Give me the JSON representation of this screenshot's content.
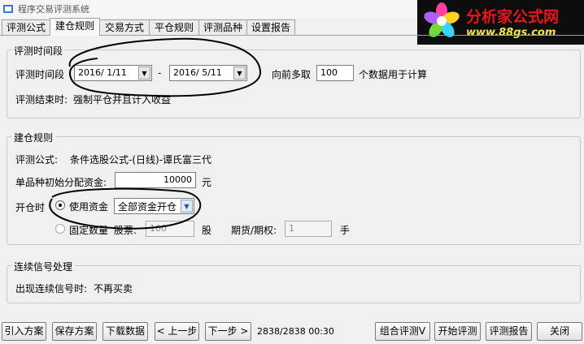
{
  "window": {
    "title": "程序交易评测系统"
  },
  "logo": {
    "brand": "分析家公式网",
    "url": "www.88gs.com"
  },
  "tabs": [
    {
      "label": "评测公式",
      "active": false
    },
    {
      "label": "建仓规则",
      "active": true
    },
    {
      "label": "交易方式",
      "active": false
    },
    {
      "label": "平仓规则",
      "active": false
    },
    {
      "label": "评测品种",
      "active": false
    },
    {
      "label": "设置报告",
      "active": false
    }
  ],
  "period_group": {
    "title": "评测时间段",
    "range_label": "评测时间段",
    "start_date": "2016/ 1/11",
    "dash": "-",
    "end_date": "2016/ 5/11",
    "lookback_label": "向前多取",
    "lookback_value": "100",
    "lookback_suffix": "个数据用于计算",
    "end_label": "评测结束时:",
    "end_value": "强制平仓并且计入收益"
  },
  "build_group": {
    "title": "建仓规则",
    "formula_label": "评测公式:",
    "formula_value": "条件选股公式-(日线)-谭氏富三代",
    "capital_label": "单品种初始分配资金:",
    "capital_value": "10000",
    "capital_unit": "元",
    "open_label": "开仓时",
    "use_funds_label": "使用资金",
    "use_funds_option": "全部资金开仓",
    "fixed_qty_label": "固定数量",
    "stock_label": "股票:",
    "stock_value": "100",
    "stock_unit": "股",
    "futures_label": "期货/期权:",
    "futures_value": "1",
    "futures_unit": "手"
  },
  "signal_group": {
    "title": "连续信号处理",
    "label": "出现连续信号时:",
    "value": "不再买卖"
  },
  "toolbar": {
    "import_label": "引入方案",
    "save_label": "保存方案",
    "download_label": "下载数据",
    "prev_label": "< 上一步",
    "next_label": "下一步 >",
    "progress_text": "2838/2838 00:30",
    "combo_eval_label": "组合评测V",
    "start_label": "开始评测",
    "report_label": "评测报告",
    "close_label": "关闭"
  },
  "colors": {
    "marker": "#000000",
    "accent_red": "#e8161e",
    "logo_yellow": "#f6e64a"
  }
}
